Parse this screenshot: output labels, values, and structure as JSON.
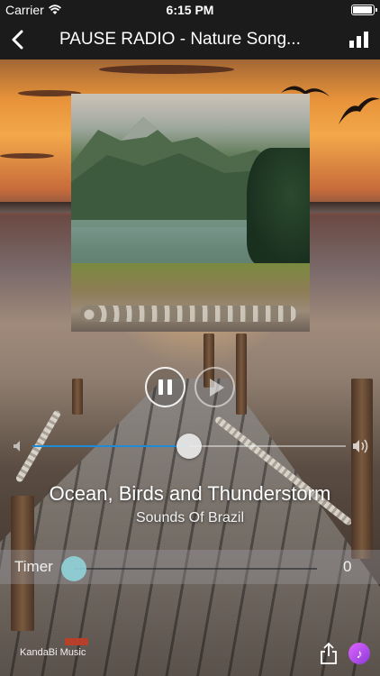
{
  "status_bar": {
    "carrier": "Carrier",
    "time": "6:15 PM",
    "battery_level": 0.95
  },
  "nav": {
    "title": "PAUSE RADIO - Nature Song...",
    "back_icon": "chevron-left-icon",
    "stats_icon": "bar-chart-icon"
  },
  "player": {
    "pause_icon": "pause-icon",
    "play_icon": "play-icon",
    "volume_level": 0.5,
    "track_title": "Ocean, Birds and Thunderstorm",
    "artist": "Sounds Of Brazil"
  },
  "timer": {
    "label": "Timer",
    "value": "0"
  },
  "footer": {
    "brand": "KandaBi Music",
    "share_icon": "share-icon",
    "music_icon": "music-note-icon"
  },
  "colors": {
    "bar_bg": "#1b1b1b",
    "volume_fill": "#1f8bd6",
    "timer_knob": "#8fd3d8",
    "music_icon": "#b84ee8"
  }
}
